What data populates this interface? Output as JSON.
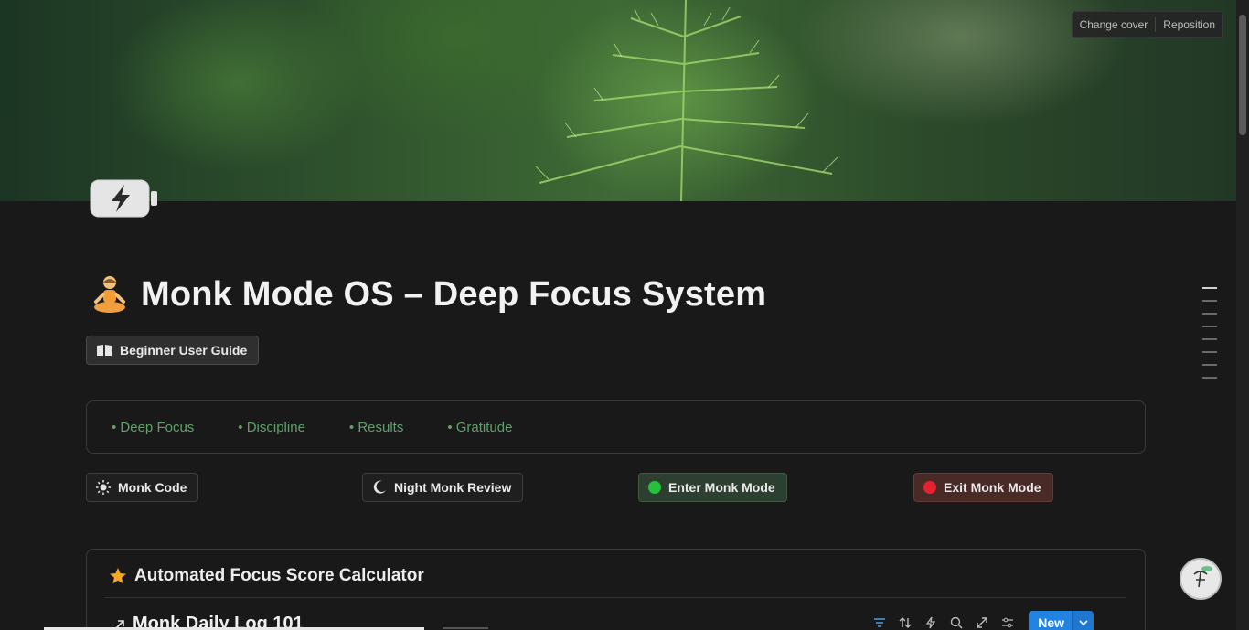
{
  "cover": {
    "change_cover_label": "Change cover",
    "reposition_label": "Reposition"
  },
  "page": {
    "icon": "battery-charging-icon",
    "title_emoji": "person-meditating-icon",
    "title": "Monk Mode OS – Deep Focus System"
  },
  "guide_button": {
    "icon": "open-book-icon",
    "label": "Beginner User Guide"
  },
  "values": [
    "• Deep Focus",
    "• Discipline",
    "• Results",
    "• Gratitude"
  ],
  "actions": {
    "monk_code": {
      "icon": "sun-icon",
      "label": "Monk Code"
    },
    "night_review": {
      "icon": "moon-icon",
      "label": "Night Monk Review"
    },
    "enter": {
      "icon": "green-circle-icon",
      "label": "Enter Monk Mode"
    },
    "exit": {
      "icon": "red-circle-icon",
      "label": "Exit Monk Mode"
    }
  },
  "calculator": {
    "icon": "star-icon",
    "title": "Automated Focus Score Calculator",
    "database": {
      "link_icon": "arrow-up-right-icon",
      "title": "Monk Daily Log 101",
      "tools": [
        "filter-icon",
        "sort-icon",
        "lightning-icon",
        "search-icon",
        "expand-icon",
        "settings-icon"
      ],
      "new_label": "New"
    }
  },
  "colors": {
    "background": "#191919",
    "values_text": "#5ea26b",
    "enter_bg": "#2d3f31",
    "exit_bg": "#4a2a27",
    "new_button": "#2383e2"
  }
}
